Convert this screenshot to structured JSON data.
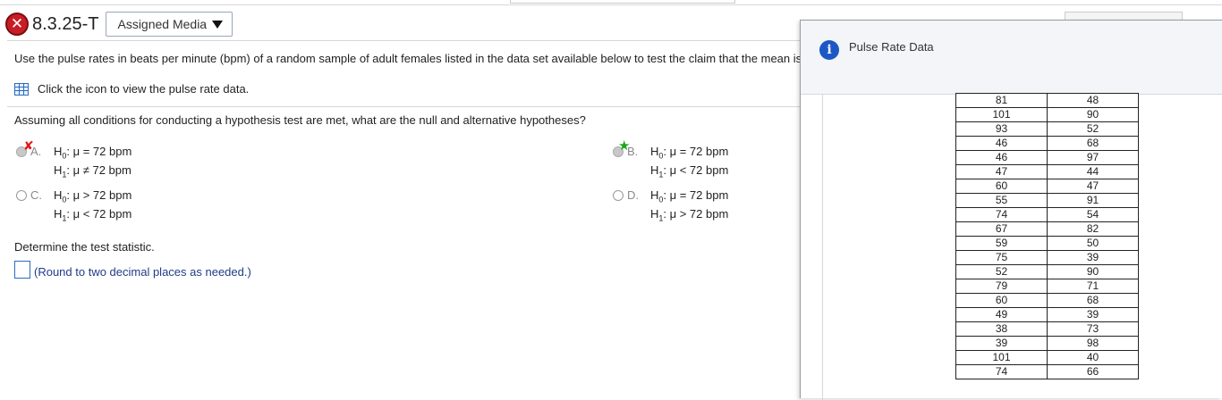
{
  "question": {
    "number": "8.3.25-T",
    "status_icon": "x-icon",
    "media_button": "Assigned Media",
    "prompt": "Use the pulse rates in beats per minute (bpm) of a random sample of adult females listed in the data set available below to test the claim that the mean is",
    "icon_instruction": "Click the icon to view the pulse rate data.",
    "hypothesis_question": "Assuming all conditions for conducting a hypothesis test are met, what are the null and alternative hypotheses?",
    "options": [
      {
        "letter": "A.",
        "h0_sym": "H",
        "h0_sub": "0",
        "h0_rest": ": μ = 72 bpm",
        "h1_sym": "H",
        "h1_sub": "1",
        "h1_rest": ": μ ≠ 72 bpm",
        "mark": "✘"
      },
      {
        "letter": "B.",
        "h0_sym": "H",
        "h0_sub": "0",
        "h0_rest": ": μ = 72 bpm",
        "h1_sym": "H",
        "h1_sub": "1",
        "h1_rest": ": μ < 72 bpm",
        "mark": "★"
      },
      {
        "letter": "C.",
        "h0_sym": "H",
        "h0_sub": "0",
        "h0_rest": ": μ > 72 bpm",
        "h1_sym": "H",
        "h1_sub": "1",
        "h1_rest": ": μ < 72 bpm",
        "mark": ""
      },
      {
        "letter": "D.",
        "h0_sym": "H",
        "h0_sub": "0",
        "h0_rest": ": μ = 72 bpm",
        "h1_sym": "H",
        "h1_sub": "1",
        "h1_rest": ": μ > 72 bpm",
        "mark": ""
      }
    ],
    "test_statistic_prompt": "Determine the test statistic.",
    "round_note": "(Round to two decimal places as needed.)"
  },
  "popup": {
    "title": "Pulse Rate Data",
    "rows": [
      [
        "81",
        "48"
      ],
      [
        "101",
        "90"
      ],
      [
        "93",
        "52"
      ],
      [
        "46",
        "68"
      ],
      [
        "46",
        "97"
      ],
      [
        "47",
        "44"
      ],
      [
        "60",
        "47"
      ],
      [
        "55",
        "91"
      ],
      [
        "74",
        "54"
      ],
      [
        "67",
        "82"
      ],
      [
        "59",
        "50"
      ],
      [
        "75",
        "39"
      ],
      [
        "52",
        "90"
      ],
      [
        "79",
        "71"
      ],
      [
        "60",
        "68"
      ],
      [
        "49",
        "39"
      ],
      [
        "38",
        "73"
      ],
      [
        "39",
        "98"
      ],
      [
        "101",
        "40"
      ],
      [
        "74",
        "66"
      ]
    ]
  },
  "colors": {
    "incorrect": "#c81d25",
    "correct_star": "#1aa51a",
    "link_blue": "#1f3c88",
    "info_blue": "#1c58c5"
  }
}
